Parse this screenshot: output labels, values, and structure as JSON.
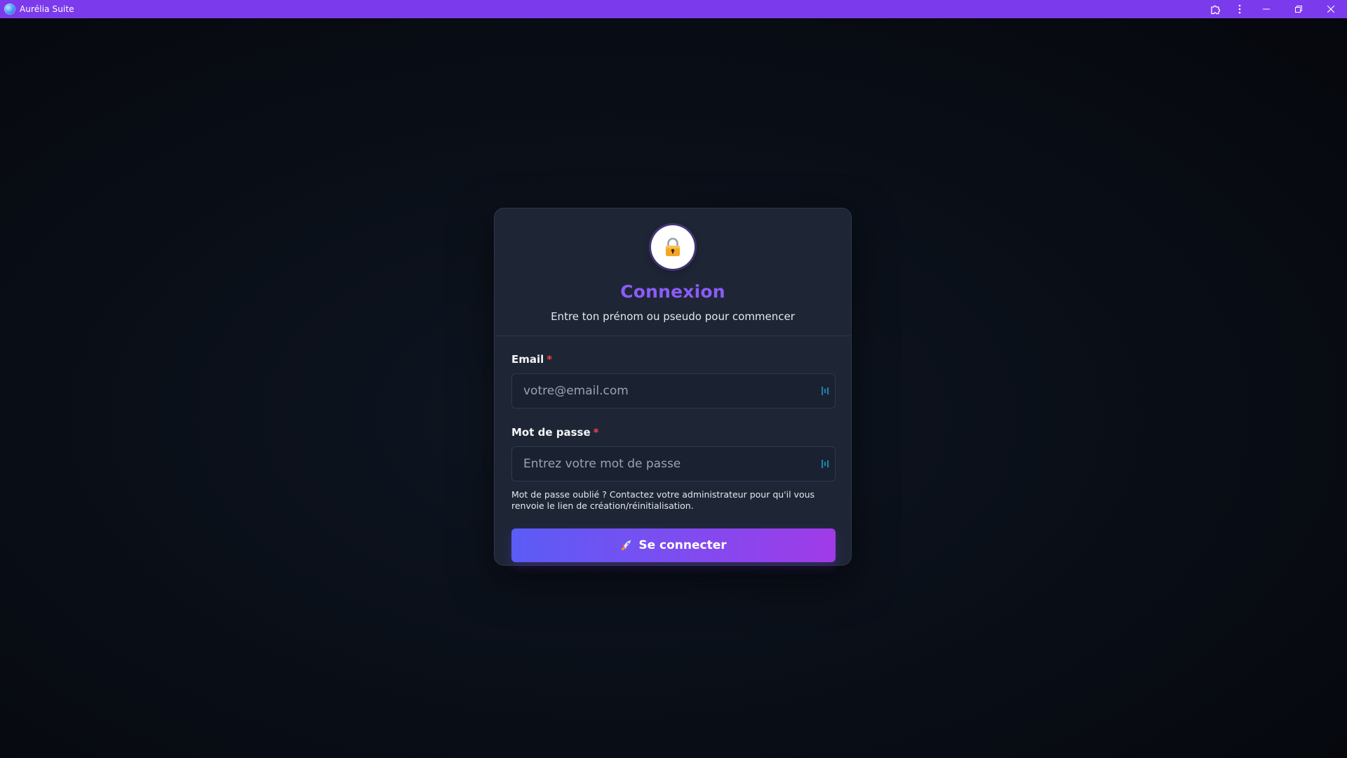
{
  "window": {
    "title": "Aurélia Suite"
  },
  "card": {
    "title": "Connexion",
    "subtitle": "Entre ton prénom ou pseudo pour commencer",
    "icon": "lock-icon"
  },
  "form": {
    "email": {
      "label": "Email",
      "required_mark": "*",
      "value": "",
      "placeholder": "votre@email.com"
    },
    "password": {
      "label": "Mot de passe",
      "required_mark": "*",
      "value": "",
      "placeholder": "Entrez votre mot de passe"
    },
    "help_text": "Mot de passe oublié ? Contactez votre administrateur pour qu'il vous renvoie le lien de création/réinitialisation.",
    "submit_label": "Se connecter",
    "submit_icon": "rocket-icon"
  },
  "colors": {
    "titlebar": "#7c3aed",
    "title_accent": "#8b5cf6",
    "required": "#ef4444",
    "button_start": "#5b5cf6",
    "button_end": "#a03be8",
    "card_bg": "#1e2636"
  }
}
